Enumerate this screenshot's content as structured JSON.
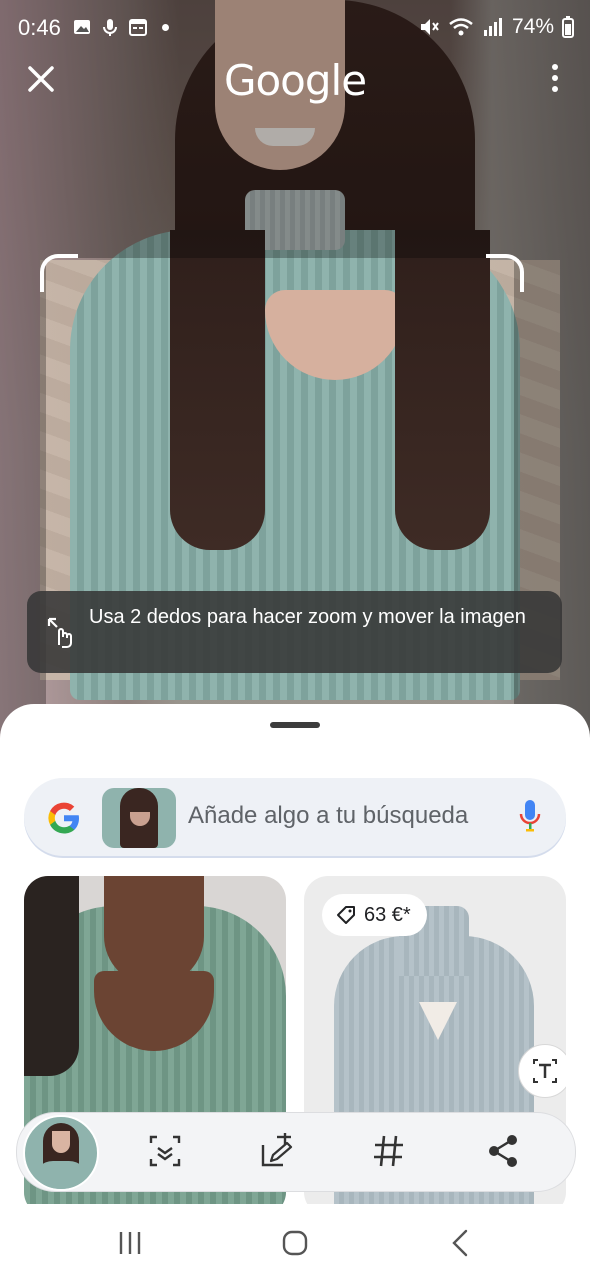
{
  "status_bar": {
    "time": "0:46",
    "battery": "74%"
  },
  "header": {
    "logo": "Google"
  },
  "toast": {
    "text": "Usa 2 dedos para hacer zoom y mover la imagen"
  },
  "search": {
    "placeholder": "Añade algo a tu búsqueda"
  },
  "results": [
    {
      "kind": "image"
    },
    {
      "kind": "image",
      "price": "63 €*"
    }
  ],
  "colors": {
    "google_blue": "#4285F4",
    "google_red": "#EA4335",
    "google_yellow": "#FBBC05",
    "google_green": "#34A853",
    "sheet_bg": "#FFFFFF",
    "searchbar_bg": "#EEF1F6"
  },
  "icons": {
    "close": "close-icon",
    "more": "more-vert-icon",
    "zoom_gesture": "pinch-zoom-icon",
    "mic": "mic-icon",
    "price_tag": "tag-icon",
    "text_select": "text-select-icon",
    "scan": "scan-icon",
    "add_to_search": "add-to-search-icon",
    "hashtag": "hashtag-icon",
    "share": "share-icon",
    "nav_recents": "recents-icon",
    "nav_home": "home-icon",
    "nav_back": "back-icon"
  }
}
